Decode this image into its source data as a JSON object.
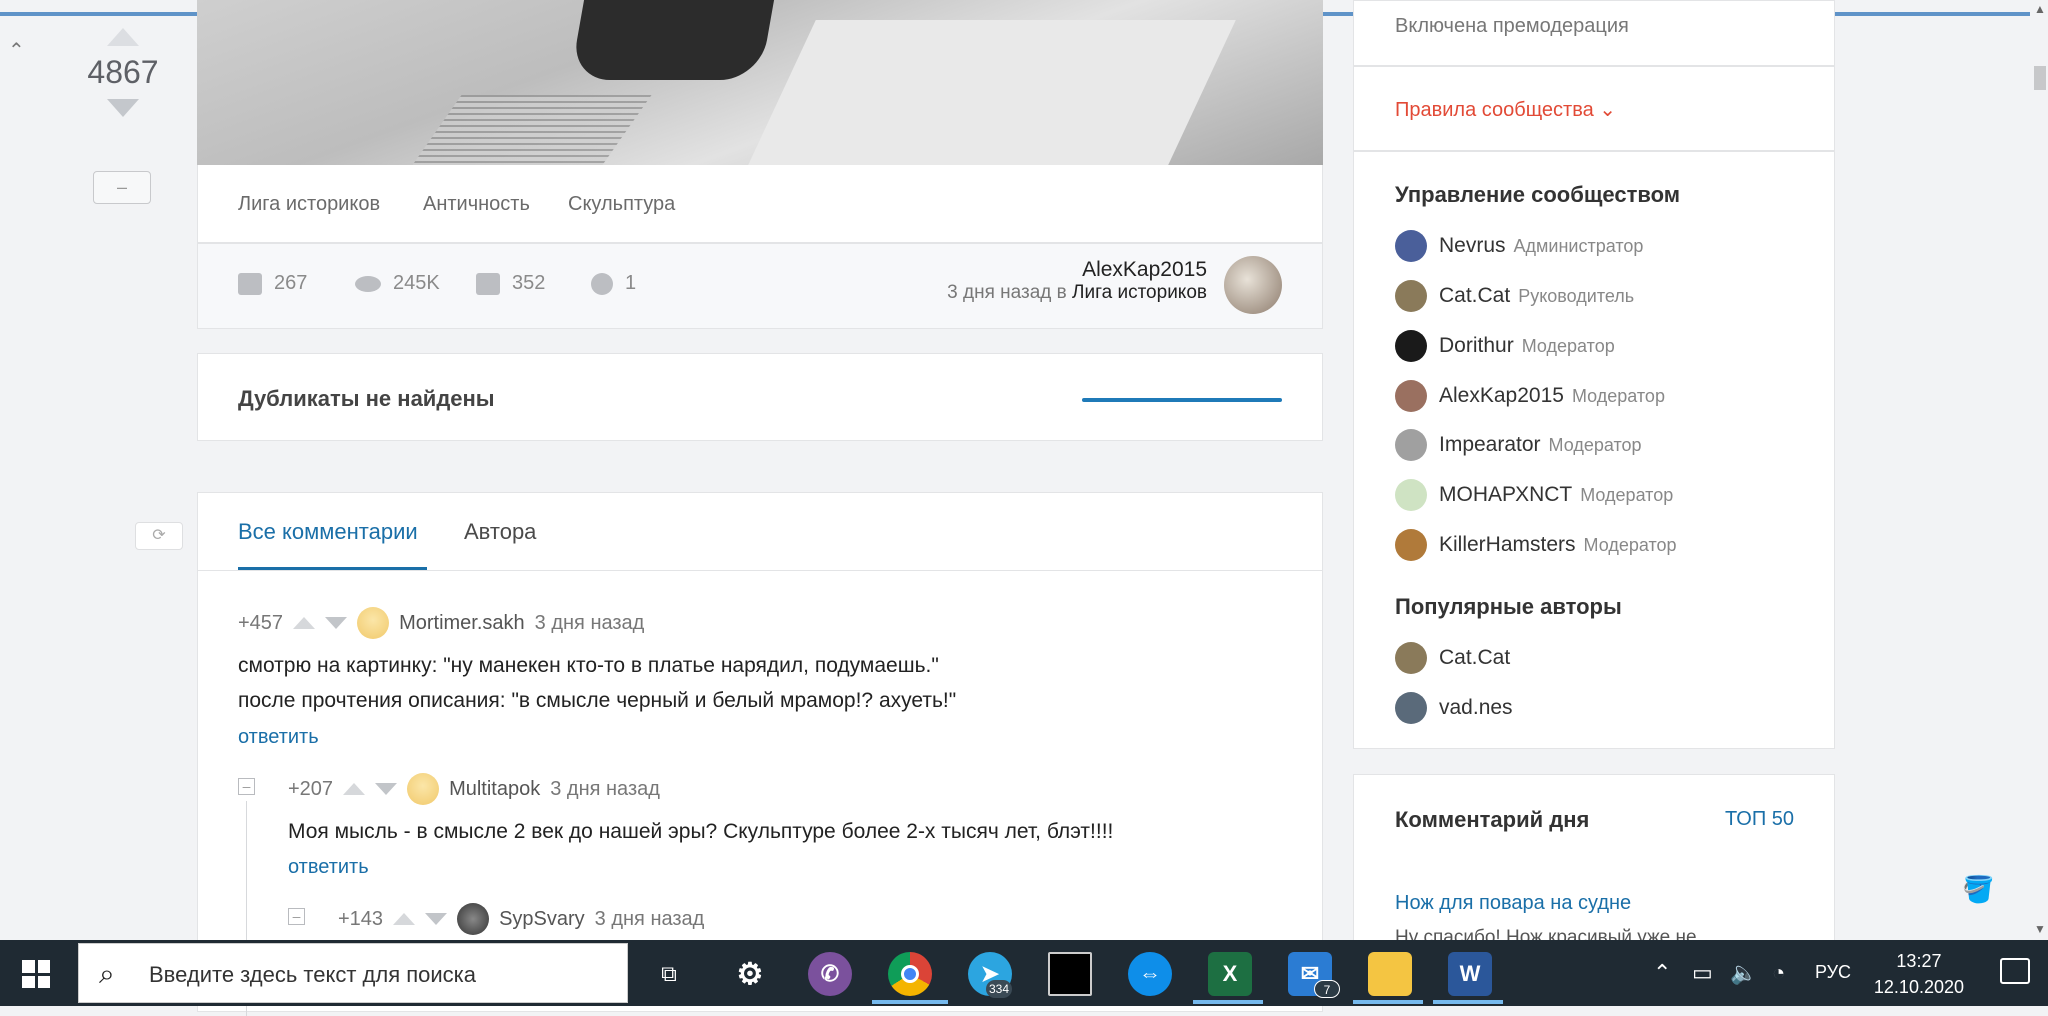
{
  "post": {
    "rating": "4867",
    "tags": [
      "Лига историков",
      "Античность",
      "Скульптура"
    ],
    "comments_count": "267",
    "views": "245K",
    "saves": "352",
    "shares": "1",
    "author": "AlexKap2015",
    "posted_ago": "3 дня назад в",
    "community": "Лига историков"
  },
  "duplicates": {
    "text": "Дубликаты не найдены"
  },
  "comments_section": {
    "tabs": [
      "Все комментарии",
      "Автора"
    ],
    "items": [
      {
        "score": "+457",
        "nick": "Mortimer.sakh",
        "time": "3 дня назад",
        "lines": [
          "смотрю на картинку: \"ну манекен кто-то в платье нарядил, подумаешь.\"",
          "после прочтения описания: \"в смысле черный и белый мрамор!? ахуеть!\""
        ],
        "reply": "ответить"
      },
      {
        "score": "+207",
        "nick": "Multitapok",
        "time": "3 дня назад",
        "lines": [
          "Моя мысль - в смысле 2 век до нашей эры? Скульптуре более 2-х тысяч лет, блэт!!!!"
        ],
        "reply": "ответить"
      },
      {
        "score": "+143",
        "nick": "SypSvary",
        "time": "3 дня назад"
      }
    ]
  },
  "sidebar": {
    "premod": "Включена премодерация",
    "rules": "Правила сообщества",
    "management_title": "Управление сообществом",
    "members": [
      {
        "name": "Nevrus",
        "role": "Администратор",
        "color": "#4a5f9a"
      },
      {
        "name": "Cat.Cat",
        "role": "Руководитель",
        "color": "#8a7a5a"
      },
      {
        "name": "Dorithur",
        "role": "Модератор",
        "color": "#1a1a1a"
      },
      {
        "name": "AlexKap2015",
        "role": "Модератор",
        "color": "#9a7060"
      },
      {
        "name": "Impearator",
        "role": "Модератор",
        "color": "#a0a0a0"
      },
      {
        "name": "МОНАРХNCT",
        "role": "Модератор",
        "color": "#cfe3c3"
      },
      {
        "name": "KillerHamsters",
        "role": "Модератор",
        "color": "#b07a3a"
      }
    ],
    "popular_title": "Популярные авторы",
    "popular": [
      {
        "name": "Cat.Cat",
        "color": "#8a7a5a"
      },
      {
        "name": "vad.nes",
        "color": "#5a6a7a"
      }
    ],
    "comment_of_day": "Комментарий дня",
    "top50": "ТОП 50",
    "cod_title": "Нож для повара на судне",
    "cod_snippet": "Ну спасибо! Нож красивый уже не"
  },
  "taskbar": {
    "search_placeholder": "Введите здесь текст для поиска",
    "telegram_badge": "334",
    "mail_badge": "7",
    "lang": "РУС",
    "time": "13:27",
    "date": "12.10.2020"
  }
}
